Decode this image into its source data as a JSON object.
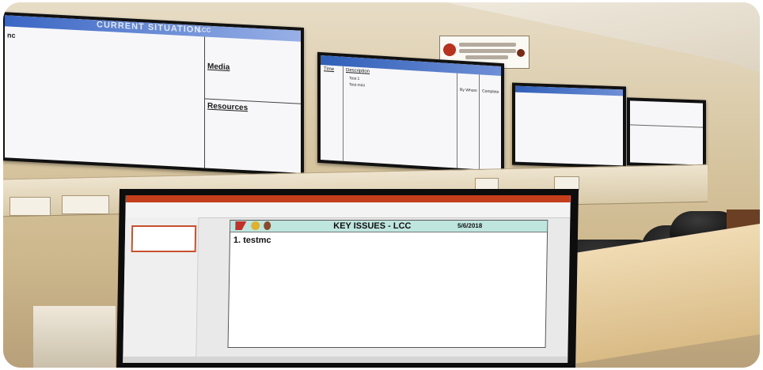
{
  "screens": {
    "tv1": {
      "banner": "CURRENT SITUATION",
      "banner_suffix": "LCC",
      "left_edge_text": "nc",
      "media_label": "Media",
      "resources_label": "Resources"
    },
    "tv2": {
      "col_time": "Time",
      "col_description": "Description",
      "items": [
        "Test 1",
        "Test mini"
      ],
      "col_bywhom": "By Whom",
      "col_complete": "Complete"
    }
  },
  "monitor": {
    "slide_title": "KEY ISSUES - LCC",
    "slide_date": "5/6/2018",
    "item_1": "1. testmc"
  },
  "colors": {
    "slide_header": "#bfe6de",
    "ribbon_accent": "#c43e1c",
    "tv_titlebar": "#2f5fb8"
  }
}
